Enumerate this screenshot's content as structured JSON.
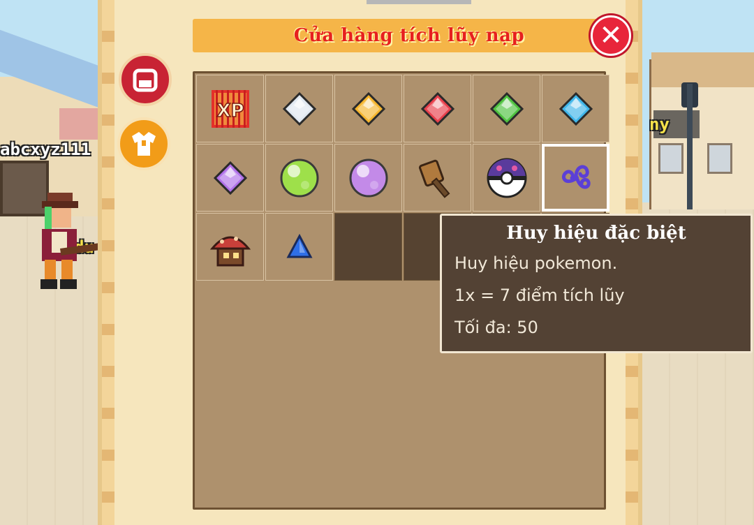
{
  "world": {
    "name_left": "abcxyz111",
    "name_player": "du",
    "name_right": "ny"
  },
  "dialog": {
    "title": "Cửa hàng tích lũy nạp",
    "close_label": "✕",
    "tabs": [
      {
        "id": "bag",
        "icon": "bag-icon"
      },
      {
        "id": "shirt",
        "icon": "shirt-icon"
      }
    ]
  },
  "items": [
    {
      "icon": "xp-card-icon"
    },
    {
      "icon": "white-gem-icon",
      "color": "#dfe7f0"
    },
    {
      "icon": "yellow-gem-icon",
      "color": "#f5b52e"
    },
    {
      "icon": "red-gem-icon",
      "color": "#e8404c"
    },
    {
      "icon": "green-gem-icon",
      "color": "#4ec23f"
    },
    {
      "icon": "blue-gem-icon",
      "color": "#3fb6ea"
    },
    {
      "icon": "purple-gem-icon",
      "color": "#b070e8"
    },
    {
      "icon": "green-orb-icon",
      "color": "#9ee04a"
    },
    {
      "icon": "purple-orb-icon",
      "color": "#c38ae8"
    },
    {
      "icon": "hammer-icon",
      "color": "#b07a3e"
    },
    {
      "icon": "master-ball-icon",
      "color": "#5a3b9c"
    },
    {
      "icon": "spiral-badge-icon",
      "color": "#5b3fd6",
      "selected": true
    },
    {
      "icon": "mushroom-hat-icon",
      "color": "#c8403a"
    },
    {
      "icon": "blue-triangle-icon",
      "color": "#2f6fe8"
    }
  ],
  "empty_slots": 4,
  "tooltip": {
    "title": "Huy hiệu đặc biệt",
    "line1": "Huy hiệu pokemon.",
    "line2": "1x = 7 điểm tích lũy",
    "line3": "Tối đa: 50"
  }
}
